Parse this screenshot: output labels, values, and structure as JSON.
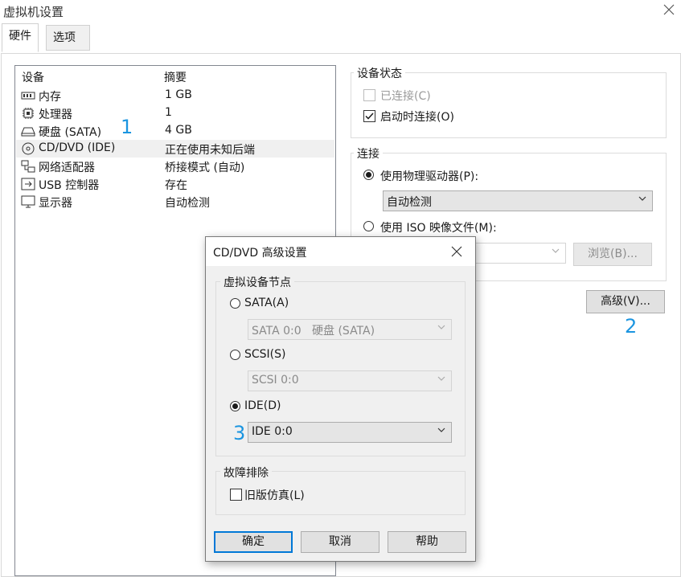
{
  "window": {
    "title": "虚拟机设置"
  },
  "tabs": [
    {
      "label": "硬件",
      "active": true
    },
    {
      "label": "选项",
      "active": false
    }
  ],
  "device_list": {
    "columns": {
      "device": "设备",
      "summary": "摘要"
    },
    "rows": [
      {
        "name": "内存",
        "summary": "1 GB",
        "icon": "memory-icon"
      },
      {
        "name": "处理器",
        "summary": "1",
        "icon": "cpu-icon"
      },
      {
        "name": "硬盘 (SATA)",
        "summary": "4 GB",
        "icon": "harddisk-icon"
      },
      {
        "name": "CD/DVD (IDE)",
        "summary": "正在使用未知后端",
        "icon": "cd-dvd-icon",
        "selected": true
      },
      {
        "name": "网络适配器",
        "summary": "桥接模式 (自动)",
        "icon": "network-icon"
      },
      {
        "name": "USB 控制器",
        "summary": "存在",
        "icon": "usb-icon"
      },
      {
        "name": "显示器",
        "summary": "自动检测",
        "icon": "monitor-icon"
      }
    ]
  },
  "device_status": {
    "label": "设备状态",
    "connected": {
      "label": "已连接(C)",
      "checked": false,
      "disabled": true
    },
    "connect_at_power_on": {
      "label": "启动时连接(O)",
      "checked": true
    }
  },
  "connection": {
    "label": "连接",
    "physical": {
      "label": "使用物理驱动器(P):",
      "selected": true,
      "value": "自动检测"
    },
    "iso": {
      "label": "使用 ISO 映像文件(M):",
      "selected": false,
      "browse_label": "浏览(B)..."
    },
    "advanced_label": "高级(V)..."
  },
  "annotations": {
    "a1": "1",
    "a2": "2",
    "a3": "3"
  },
  "dialog": {
    "title": "CD/DVD 高级设置",
    "node_group_label": "虚拟设备节点",
    "sata": {
      "label": "SATA(A)",
      "selected": false,
      "value": "SATA 0:0   硬盘 (SATA)"
    },
    "scsi": {
      "label": "SCSI(S)",
      "selected": false,
      "value": "SCSI 0:0"
    },
    "ide": {
      "label": "IDE(D)",
      "selected": true,
      "value": "IDE 0:0"
    },
    "trouble_group_label": "故障排除",
    "legacy": {
      "label": "旧版仿真(L)",
      "checked": false
    },
    "ok_label": "确定",
    "cancel_label": "取消",
    "help_label": "帮助"
  },
  "colors": {
    "accent": "#0078d7",
    "annotation": "#1b95e0",
    "selected_row": "#f0f0f0"
  }
}
